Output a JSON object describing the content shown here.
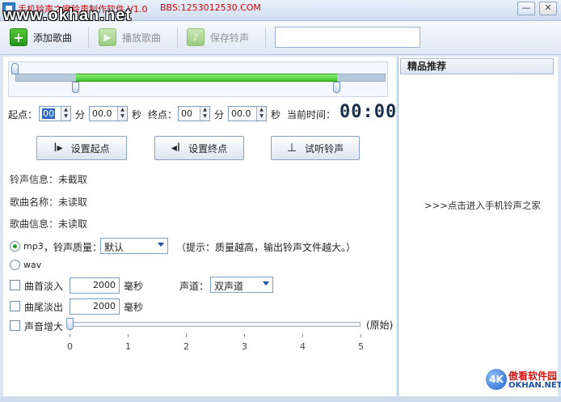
{
  "window": {
    "title": "手机铃声之家铃声制作软件 V1.0",
    "bbs": "BBS:1253012530.COM",
    "watermark": "www.okhan.net",
    "minimize": "—",
    "close": "✕"
  },
  "toolbar": {
    "add_label": "添加歌曲",
    "play_label": "播放歌曲",
    "save_label": "保存铃声",
    "search_value": ""
  },
  "range": {
    "start_fraction": 0.15,
    "end_fraction": 0.855
  },
  "time": {
    "start_label": "起点：",
    "start_min": "00",
    "min_unit": "分",
    "start_sec": "00.0",
    "sec_unit": "秒",
    "end_label": "终点：",
    "end_min": "00",
    "end_sec": "00.0",
    "current_label": "当前时间：",
    "current_value": "00:00"
  },
  "actions": {
    "set_start": "设置起点",
    "set_end": "设置终点",
    "preview": "试听铃声"
  },
  "info": {
    "ringtone": "铃声信息：未截取",
    "song_name": "歌曲名称：未读取",
    "song_info": "歌曲信息：未读取"
  },
  "format": {
    "mp3": "mp3",
    "quality_label": "，铃声质量：",
    "quality_value": "默认",
    "tip": "（提示：质量越高，输出铃声文件越大。）",
    "wav": "wav",
    "selected": "mp3"
  },
  "effects": {
    "fade_in": "曲首淡入",
    "fade_in_value": "2000",
    "fade_out": "曲尾淡出",
    "fade_out_value": "2000",
    "ms_unit": "毫秒",
    "channel_label": "声道：",
    "channel_value": "双声道",
    "volume_label": "声音增大",
    "volume_hint": "(原始)",
    "volume_level": 0,
    "ticks": [
      "0",
      "1",
      "2",
      "3",
      "4",
      "5"
    ]
  },
  "sidebar": {
    "header": "精品推荐",
    "link": ">>>点击进入手机铃声之家",
    "brand_logo": "4K",
    "brand_cn": "傲看软件园",
    "brand_en": "OKHAN.NET"
  }
}
